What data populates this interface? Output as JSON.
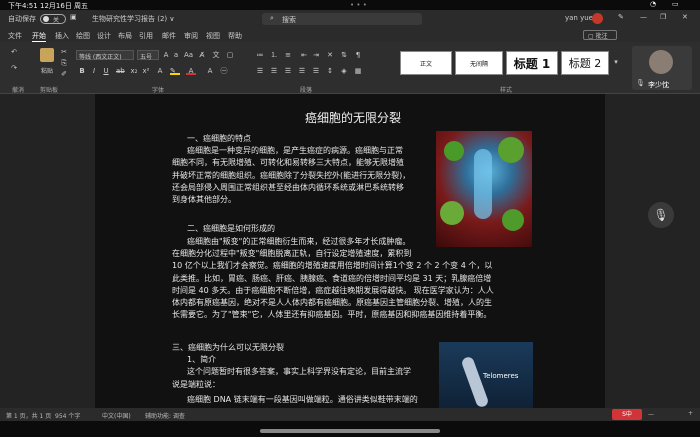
{
  "system": {
    "time": "下午4:51",
    "date": "12月16日 周五",
    "user": "yan yue",
    "battery": "▮"
  },
  "titlebar": {
    "autosave_label": "自动保存",
    "autosave_state": "关",
    "doc_title": "生物研究性学习报告 (2) ∨",
    "search_placeholder": "搜索"
  },
  "menu": {
    "items": [
      "文件",
      "开始",
      "插入",
      "绘图",
      "设计",
      "布局",
      "引用",
      "邮件",
      "审阅",
      "视图",
      "帮助"
    ],
    "comment_button": "批注",
    "edit_button": "编辑"
  },
  "ribbon": {
    "groups": [
      "撤消",
      "剪贴板",
      "字体",
      "段落",
      "样式"
    ],
    "paste_label": "粘贴",
    "font_name": "等线 (西文正文)",
    "font_size": "五号",
    "styles": [
      "正文",
      "无间隔",
      "标题 1",
      "标题 2"
    ],
    "participant": "李少忱"
  },
  "document": {
    "title": "癌细胞的无限分裂",
    "sections": [
      {
        "heading": "一、癌细胞的特点",
        "lines": [
          "癌细胞是一种变异的细胞，是产生癌症的病源。癌细胞与正常",
          "细胞不同，有无限增殖、可转化和易转移三大特点，能够无限增殖",
          "并破坏正常的细胞组织。癌细胞除了分裂失控外(能进行无限分裂)，",
          "还会局部侵入周围正常组织甚至经由体内循环系统或淋巴系统转移",
          "到身体其他部分。"
        ]
      },
      {
        "heading": "二、癌细胞是如何形成的",
        "lines": [
          "癌细胞由\"叛变\"的正常细胞衍生而来，经过很多年才长成肿瘤。",
          "在细胞分化过程中\"叛变\"细胞脱离正轨，自行设定增殖速度，累积到",
          "10 亿个以上我们才会察觉。癌细胞的增殖速度用倍增时间计算1个变 2 个 2 个变 4 个，以",
          "此类推。比如，胃癌、肠癌、肝癌、胰腺癌、食道癌的倍增时间平均是 31 天；乳腺癌倍增",
          "时间是 40 多天。由于癌细胞不断倍增，癌症越往晚期发展得越快。 现在医学家认为：人人",
          "体内都有原癌基因，绝对不是人人体内都有癌细胞。原癌基因主管细胞分裂、增殖，人的生",
          "长需要它。为了\"管束\"它，人体里还有抑癌基因。平时，原癌基因和抑癌基因维持着平衡。"
        ]
      },
      {
        "heading": "三、癌细胞为什么可以无限分裂",
        "lines": [
          "1、简介",
          "这个问题暂时有很多答案，事实上科学界没有定论，目前主流学",
          "说是端粒说：",
          "癌细胞 DNA 链末端有一段基因叫做端粒。通俗讲类似鞋带末端的"
        ]
      }
    ],
    "image2_label": "Telomeres"
  },
  "status": {
    "page": "第 1 页，共 1 页",
    "words": "954 个字",
    "lang": "中文(中国)",
    "accessibility": "辅助功能: 调查",
    "zoom_minus": "—",
    "zoom_plus": "+"
  },
  "colors": {
    "accent_red": "#d13438",
    "ribbon_bg": "#2e2e2e"
  }
}
